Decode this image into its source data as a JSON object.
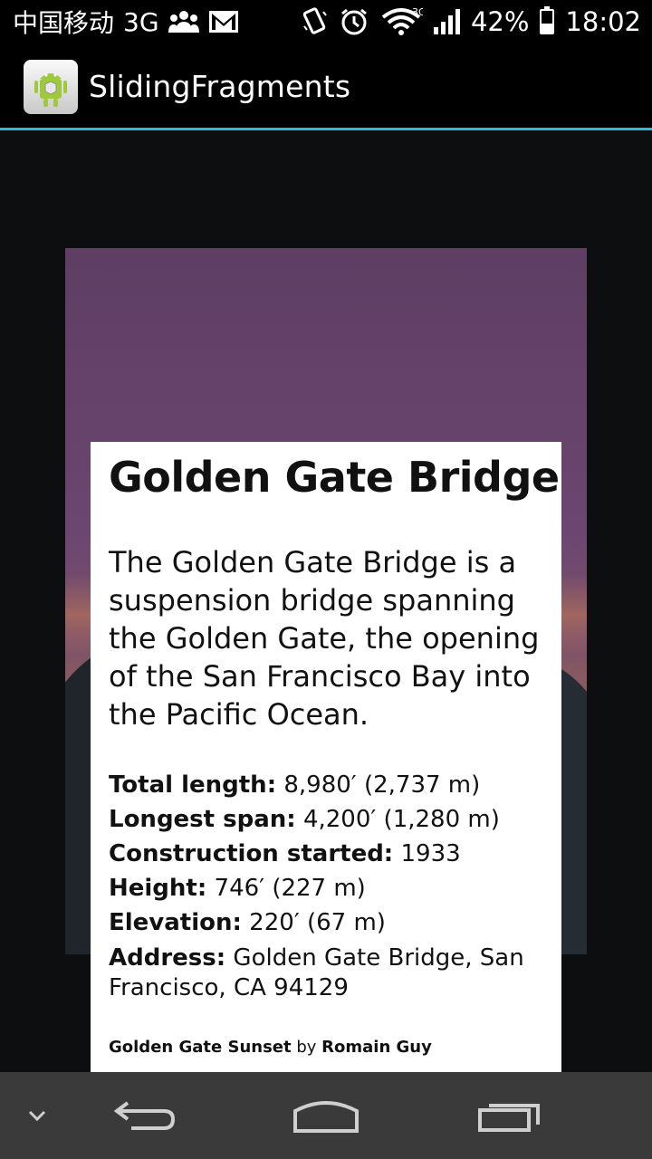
{
  "status_bar": {
    "carrier": "中国移动",
    "network": "3G",
    "wifi_badge": "3G",
    "battery": "42%",
    "time": "18:02",
    "icons": [
      "people-icon",
      "gmail-icon",
      "vibrate-icon",
      "alarm-icon",
      "wifi-icon",
      "signal-icon",
      "battery-charging-icon"
    ]
  },
  "action_bar": {
    "title": "SlidingFragments",
    "app_icon": "android-app-icon",
    "accent_color": "#33b5e5"
  },
  "card": {
    "title": "Golden Gate Bridge",
    "description": "The Golden Gate Bridge is a suspension bridge spanning the Golden Gate, the opening of the San Francisco Bay into the Pacific Ocean.",
    "facts": [
      {
        "label": "Total length:",
        "value": " 8,980′ (2,737 m)"
      },
      {
        "label": "Longest span:",
        "value": " 4,200′ (1,280 m)"
      },
      {
        "label": "Construction started:",
        "value": " 1933"
      },
      {
        "label": "Height:",
        "value": " 746′ (227 m)"
      },
      {
        "label": "Elevation:",
        "value": " 220′ (67 m)"
      },
      {
        "label": "Address:",
        "value": " Golden Gate Bridge, San Francisco, CA 94129"
      }
    ],
    "credit": {
      "photo": "Golden Gate Sunset",
      "by": " by ",
      "author": "Romain Guy"
    }
  },
  "nav_bar": {
    "buttons": [
      "hide-keyboard-icon",
      "back-icon",
      "home-icon",
      "recents-icon"
    ]
  }
}
